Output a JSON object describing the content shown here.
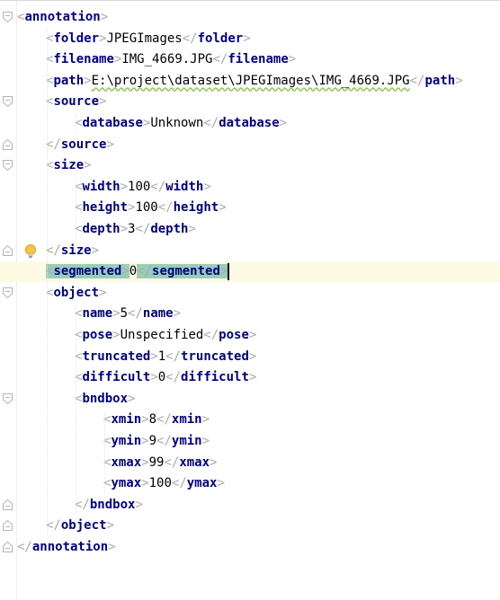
{
  "editor": {
    "lines": [
      {
        "tag": "annotation",
        "close": false
      },
      {
        "tag": "folder",
        "value": "JPEGImages"
      },
      {
        "tag": "filename",
        "value": "IMG_4669.JPG"
      },
      {
        "tag": "path",
        "value": "E:\\project\\dataset\\JPEGImages\\IMG_4669.JPG"
      },
      {
        "tag": "source",
        "close": false
      },
      {
        "tag": "database",
        "value": "Unknown"
      },
      {
        "tag": "source",
        "close": true
      },
      {
        "tag": "size",
        "close": false
      },
      {
        "tag": "width",
        "value": "100"
      },
      {
        "tag": "height",
        "value": "100"
      },
      {
        "tag": "depth",
        "value": "3"
      },
      {
        "tag": "size",
        "close": true
      },
      {
        "tag": "segmented",
        "value": "0"
      },
      {
        "tag": "object",
        "close": false
      },
      {
        "tag": "name",
        "value": "5"
      },
      {
        "tag": "pose",
        "value": "Unspecified"
      },
      {
        "tag": "truncated",
        "value": "1"
      },
      {
        "tag": "difficult",
        "value": "0"
      },
      {
        "tag": "bndbox",
        "close": false
      },
      {
        "tag": "xmin",
        "value": "8"
      },
      {
        "tag": "ymin",
        "value": "9"
      },
      {
        "tag": "xmax",
        "value": "99"
      },
      {
        "tag": "ymax",
        "value": "100"
      },
      {
        "tag": "bndbox",
        "close": true
      },
      {
        "tag": "object",
        "close": true
      },
      {
        "tag": "annotation",
        "close": true
      }
    ],
    "intention_bulb_icon": "lightbulb-icon",
    "fold_icon": "fold-marker-icon",
    "colors": {
      "tag": "#000080",
      "bracket": "#aaaaaa",
      "current_line": "#fffae3",
      "match_highlight": "#99ccbb"
    }
  }
}
